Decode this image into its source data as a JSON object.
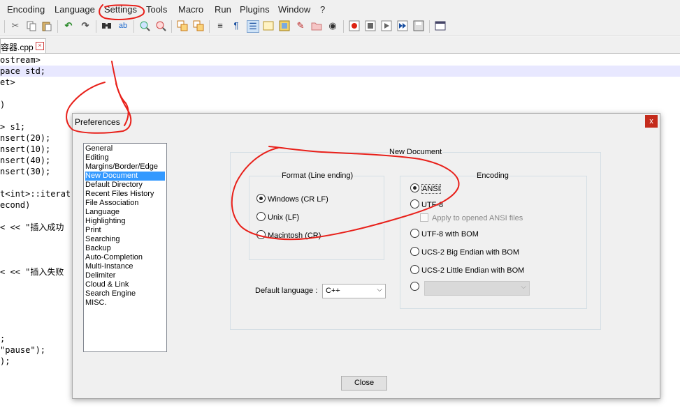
{
  "menu": [
    "Encoding",
    "Language",
    "Settings",
    "Tools",
    "Macro",
    "Run",
    "Plugins",
    "Window",
    "?"
  ],
  "toolbar": {
    "icons": [
      "cut-icon",
      "copy-icon",
      "paste-icon",
      "undo-icon",
      "redo-icon",
      "find-icon",
      "replace-icon",
      "zoom-in-icon",
      "zoom-out-icon",
      "sync-v-icon",
      "sync-h-icon",
      "wrap-icon",
      "show-all-chars-icon",
      "indent-guide-icon",
      "doc-map-icon",
      "function-list-icon",
      "folder-icon",
      "monitor-icon",
      "record-macro-icon",
      "stop-macro-icon",
      "play-macro-icon",
      "run-multiple-icon",
      "save-macro-icon",
      "launch-icon"
    ]
  },
  "tab": {
    "name": "容器.cpp",
    "close": "×"
  },
  "code_lines": [
    "ostream>",
    "pace std;",
    "et>",
    "",
    ")",
    "",
    "> s1;",
    "nsert(20);",
    "nsert(10);",
    "nsert(40);",
    "nsert(30);",
    "",
    "t<int>::iterat",
    "econd)",
    "",
    "< << \"插入成功",
    "",
    "",
    "",
    "< << \"插入失败",
    "",
    "",
    "",
    "",
    "",
    ";",
    "\"pause\");",
    ");"
  ],
  "dialog": {
    "title": "Preferences",
    "close": "x",
    "categories": [
      "General",
      "Editing",
      "Margins/Border/Edge",
      "New Document",
      "Default Directory",
      "Recent Files History",
      "File Association",
      "Language",
      "Highlighting",
      "Print",
      "Searching",
      "Backup",
      "Auto-Completion",
      "Multi-Instance",
      "Delimiter",
      "Cloud & Link",
      "Search Engine",
      "MISC."
    ],
    "selected_category": "New Document",
    "panel_title": "New Document",
    "format": {
      "label": "Format (Line ending)",
      "options": [
        "Windows (CR LF)",
        "Unix (LF)",
        "Macintosh (CR)"
      ],
      "selected": "Windows (CR LF)"
    },
    "encoding": {
      "label": "Encoding",
      "options": [
        "ANSI",
        "UTF-8",
        "UTF-8 with BOM",
        "UCS-2 Big Endian with BOM",
        "UCS-2 Little Endian with BOM"
      ],
      "selected": "ANSI",
      "apply_ansi": "Apply to opened ANSI files"
    },
    "default_language": {
      "label": "Default language :",
      "value": "C++"
    },
    "close_button": "Close"
  },
  "colors": {
    "annotation": "#e8201a",
    "selection": "#3399ff",
    "close_red": "#c42b1c"
  }
}
